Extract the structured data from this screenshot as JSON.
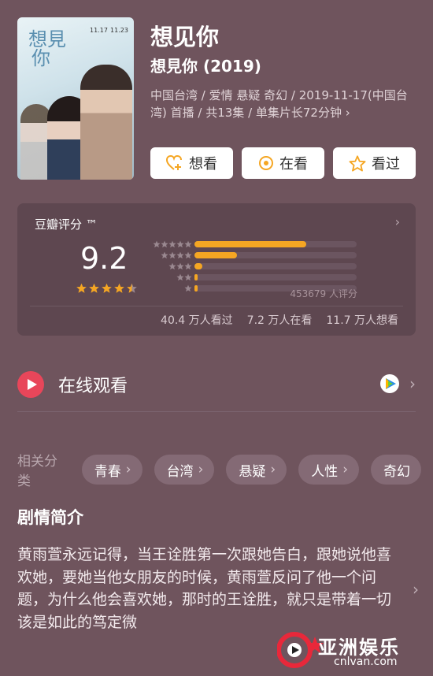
{
  "movie": {
    "title": "想见你",
    "subtitle": "想見你 (2019)",
    "meta": "中国台湾 / 爱情 悬疑 奇幻 / 2019-11-17(中国台湾) 首播 / 共13集 / 单集片长72分钟",
    "meta_chevron": "›"
  },
  "poster": {
    "title_line1": "想見",
    "title_line2": "你",
    "date1": "11.17",
    "date2": "11.23"
  },
  "actions": {
    "want": "想看",
    "watching": "在看",
    "watched": "看过"
  },
  "rating": {
    "header": "豆瓣评分 ™",
    "score": "9.2",
    "star_value": 4.5,
    "distribution": [
      {
        "stars": 5,
        "fraction": 0.69
      },
      {
        "stars": 4,
        "fraction": 0.26
      },
      {
        "stars": 3,
        "fraction": 0.05
      },
      {
        "stars": 2,
        "fraction": 0.02
      },
      {
        "stars": 1,
        "fraction": 0.02
      }
    ],
    "count_text": "453679 人评分",
    "stats": [
      "40.4 万人看过",
      "7.2 万人在看",
      "11.7 万人想看"
    ]
  },
  "watch": {
    "label": "在线观看"
  },
  "tags": {
    "label": "相关分类",
    "items": [
      "青春",
      "台湾",
      "悬疑",
      "人性",
      "奇幻"
    ]
  },
  "synopsis": {
    "title": "剧情简介",
    "text": "黄雨萱永远记得，当王诠胜第一次跟她告白，跟她说他喜欢她，要她当他女朋友的时候，黄雨萱反问了他一个问题，为什么他会喜欢她，那时的王诠胜，就只是带着一切该是如此的笃定微"
  },
  "watermark": {
    "text": "亚洲娱乐",
    "sub": "cnlvan.com"
  },
  "colors": {
    "background": "#6f545d",
    "card": "#5e4750",
    "accent_orange": "#f5a623",
    "play_red": "#e8465a"
  }
}
